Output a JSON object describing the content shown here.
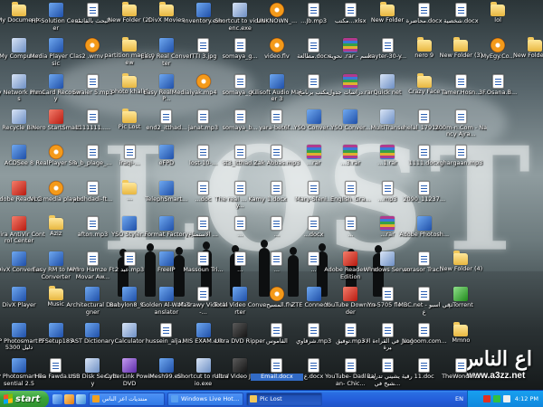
{
  "desktop": {
    "icons": [
      {
        "label": "My Documents",
        "type": "folder",
        "col": 0,
        "row": 0
      },
      {
        "label": "HP Solution Center",
        "type": "app",
        "col": 1,
        "row": 0
      },
      {
        "label": "البحث بالقائمة",
        "type": "doc",
        "col": 2,
        "row": 0
      },
      {
        "label": "New Folder (2)",
        "type": "folder",
        "col": 3,
        "row": 0
      },
      {
        "label": "DivX Movies",
        "type": "folder",
        "col": 4,
        "row": 0
      },
      {
        "label": "Inventory.exe",
        "type": "app",
        "col": 5,
        "row": 0
      },
      {
        "label": "Shortcut to videoenc.exe",
        "type": "sys",
        "col": 6,
        "row": 0
      },
      {
        "label": "UNKNOWN_...",
        "type": "media",
        "col": 7,
        "row": 0
      },
      {
        "label": "...Jb.mp3",
        "type": "doc",
        "col": 8,
        "row": 0
      },
      {
        "label": "مکتب...xlsx",
        "type": "doc",
        "col": 9,
        "row": 0
      },
      {
        "label": "New Folder",
        "type": "folder",
        "col": 10,
        "row": 0
      },
      {
        "label": "محاضرة.docx",
        "type": "doc",
        "col": 11,
        "row": 0
      },
      {
        "label": "شخصية.docx",
        "type": "doc",
        "col": 12,
        "row": 0
      },
      {
        "label": "lol",
        "type": "folder",
        "col": 13,
        "row": 0
      },
      {
        "label": "My Computer",
        "type": "sys",
        "col": 0,
        "row": 1
      },
      {
        "label": "Media Player Classic",
        "type": "app",
        "col": 1,
        "row": 1
      },
      {
        "label": "2 .wmv",
        "type": "media",
        "col": 2,
        "row": 1
      },
      {
        "label": "partition magic new",
        "type": "folder",
        "col": 3,
        "row": 1
      },
      {
        "label": "Easy Real Converter",
        "type": "app",
        "col": 4,
        "row": 1
      },
      {
        "label": "ITTI 3.jpg",
        "type": "doc",
        "col": 5,
        "row": 1
      },
      {
        "label": "somaya_g...",
        "type": "doc",
        "col": 6,
        "row": 1
      },
      {
        "label": "video.flv",
        "type": "media",
        "col": 7,
        "row": 1
      },
      {
        "label": "مطالعة.docx",
        "type": "doc",
        "col": 8,
        "row": 1
      },
      {
        "label": "نحوية .rar - قسم",
        "type": "archive",
        "col": 9,
        "row": 1
      },
      {
        "label": "kayter-30-y...",
        "type": "doc",
        "col": 10,
        "row": 1
      },
      {
        "label": "nero 9",
        "type": "folder",
        "col": 11,
        "row": 1
      },
      {
        "label": "New Folder (3)",
        "type": "folder",
        "col": 12,
        "row": 1
      },
      {
        "label": "MyEgy.Co...",
        "type": "media",
        "col": 13,
        "row": 1
      },
      {
        "label": "New Folder (5)",
        "type": "folder",
        "col": 14,
        "row": 1
      },
      {
        "label": "My Network Places",
        "type": "sys",
        "col": 0,
        "row": 2
      },
      {
        "label": "mmCard Recovery",
        "type": "app",
        "col": 1,
        "row": 2
      },
      {
        "label": "Swaier 5.mp3",
        "type": "doc",
        "col": 2,
        "row": 2
      },
      {
        "label": "photo khalid",
        "type": "folder",
        "col": 3,
        "row": 2
      },
      {
        "label": "Easy RealMedia P...",
        "type": "app",
        "col": 4,
        "row": 2
      },
      {
        "label": "iyak.mp4",
        "type": "media",
        "col": 5,
        "row": 2
      },
      {
        "label": "somaya_g...",
        "type": "doc",
        "col": 6,
        "row": 2
      },
      {
        "label": "Xilisoft Audio Maker 3",
        "type": "app",
        "col": 7,
        "row": 2
      },
      {
        "label": "مكتب برنامج",
        "type": "doc",
        "col": 8,
        "row": 2
      },
      {
        "label": "دراسات جدول.rar",
        "type": "archive",
        "col": 9,
        "row": 2
      },
      {
        "label": "Quick net",
        "type": "sys",
        "col": 10,
        "row": 2
      },
      {
        "label": "Crazy Face",
        "type": "folder",
        "col": 11,
        "row": 2
      },
      {
        "label": "Tamer.Hosn...",
        "type": "doc",
        "col": 12,
        "row": 2
      },
      {
        "label": "3F.Osana.B...",
        "type": "doc",
        "col": 13,
        "row": 2
      },
      {
        "label": "Recycle Bin",
        "type": "sys",
        "col": 0,
        "row": 3
      },
      {
        "label": "Nero StartSmart",
        "type": "red",
        "col": 1,
        "row": 3
      },
      {
        "label": "1111111.....",
        "type": "doc",
        "col": 2,
        "row": 3
      },
      {
        "label": "Pic Lost",
        "type": "folder",
        "col": 3,
        "row": 3
      },
      {
        "label": "end2_itthad...",
        "type": "doc",
        "col": 4,
        "row": 3
      },
      {
        "label": "janat.mp3",
        "type": "doc",
        "col": 5,
        "row": 3
      },
      {
        "label": "somaya_b...",
        "type": "doc",
        "col": 6,
        "row": 3
      },
      {
        "label": "yara-bet6f...",
        "type": "doc",
        "col": 7,
        "row": 3
      },
      {
        "label": "YSO Conver...",
        "type": "app",
        "col": 8,
        "row": 3
      },
      {
        "label": "YSO Conver...",
        "type": "app",
        "col": 9,
        "row": 3
      },
      {
        "label": "MultiTranse",
        "type": "sys",
        "col": 10,
        "row": 3
      },
      {
        "label": "helal_1791S...",
        "type": "doc",
        "col": 11,
        "row": 3
      },
      {
        "label": "200m-n.Com - Nancy Ajra...",
        "type": "doc",
        "col": 12,
        "row": 3
      },
      {
        "label": "ACDSee 8",
        "type": "app",
        "col": 0,
        "row": 4
      },
      {
        "label": "RealPlayer SP",
        "type": "media",
        "col": 1,
        "row": 4
      },
      {
        "label": "a_b_plage_...",
        "type": "doc",
        "col": 2,
        "row": 4
      },
      {
        "label": "iraqi-...",
        "type": "doc",
        "col": 3,
        "row": 4
      },
      {
        "label": "eFPD",
        "type": "app",
        "col": 4,
        "row": 4
      },
      {
        "label": "lost-10-...",
        "type": "doc",
        "col": 5,
        "row": 4
      },
      {
        "label": "st3_itthad...",
        "type": "doc",
        "col": 6,
        "row": 4
      },
      {
        "label": "Zak Abbas.mp3",
        "type": "doc",
        "col": 7,
        "row": 4
      },
      {
        "label": "...rar",
        "type": "archive",
        "col": 8,
        "row": 4
      },
      {
        "label": "...3.rar",
        "type": "archive",
        "col": 9,
        "row": 4
      },
      {
        "label": "...1.rar",
        "type": "archive",
        "col": 10,
        "row": 4
      },
      {
        "label": "1111.docx",
        "type": "doc",
        "col": 11,
        "row": 4
      },
      {
        "label": "ghargaan.mp3",
        "type": "doc",
        "col": 12,
        "row": 4
      },
      {
        "label": "Adobe Reader 8",
        "type": "red",
        "col": 0,
        "row": 5
      },
      {
        "label": "VLC media player",
        "type": "media",
        "col": 1,
        "row": 5
      },
      {
        "label": "abdhdadi-ft...",
        "type": "doc",
        "col": 2,
        "row": 5
      },
      {
        "label": "...",
        "type": "folder",
        "col": 3,
        "row": 5
      },
      {
        "label": "TelephSmart...",
        "type": "app",
        "col": 4,
        "row": 5
      },
      {
        "label": "...doc",
        "type": "doc",
        "col": 5,
        "row": 5
      },
      {
        "label": "The real ... Kamyy...",
        "type": "doc",
        "col": 6,
        "row": 5
      },
      {
        "label": "1.docx",
        "type": "doc",
        "col": 7,
        "row": 5
      },
      {
        "label": "Mary-Sfeni...",
        "type": "doc",
        "col": 8,
        "row": 5
      },
      {
        "label": "English_Gra...",
        "type": "doc",
        "col": 9,
        "row": 5
      },
      {
        "label": "...mp3",
        "type": "doc",
        "col": 10,
        "row": 5
      },
      {
        "label": "2090_11237...",
        "type": "doc",
        "col": 11,
        "row": 5
      },
      {
        "label": "Avira AntiVir Control Center",
        "type": "red",
        "col": 0,
        "row": 6
      },
      {
        "label": "Aziz",
        "type": "folder",
        "col": 1,
        "row": 6
      },
      {
        "label": "afton.mp3",
        "type": "doc",
        "col": 2,
        "row": 6
      },
      {
        "label": "YSO Styler...",
        "type": "app",
        "col": 3,
        "row": 6
      },
      {
        "label": "Format Factory",
        "type": "app",
        "col": 4,
        "row": 6
      },
      {
        "label": "الاستمتاع ...",
        "type": "doc",
        "col": 5,
        "row": 6
      },
      {
        "label": "...",
        "type": "doc",
        "col": 6,
        "row": 6
      },
      {
        "label": "...",
        "type": "doc",
        "col": 7,
        "row": 6
      },
      {
        "label": "...docx",
        "type": "doc",
        "col": 8,
        "row": 6
      },
      {
        "label": "...",
        "type": "doc",
        "col": 9,
        "row": 6
      },
      {
        "label": "...rar",
        "type": "archive",
        "col": 10,
        "row": 6
      },
      {
        "label": "Adobe Photosh...",
        "type": "app",
        "col": 11,
        "row": 6
      },
      {
        "label": "DivX Converter",
        "type": "app",
        "col": 0,
        "row": 7
      },
      {
        "label": "Easy RM to MP3 Converter",
        "type": "app",
        "col": 1,
        "row": 7
      },
      {
        "label": "Amro Hamze Ft. Movar Aw...",
        "type": "doc",
        "col": 2,
        "row": 7
      },
      {
        "label": "عبد 2.mp3",
        "type": "doc",
        "col": 3,
        "row": 7
      },
      {
        "label": "FreeIP",
        "type": "app",
        "col": 4,
        "row": 7
      },
      {
        "label": "Massoun Tri...",
        "type": "doc",
        "col": 5,
        "row": 7
      },
      {
        "label": "...",
        "type": "doc",
        "col": 6,
        "row": 7
      },
      {
        "label": "...",
        "type": "doc",
        "col": 7,
        "row": 7
      },
      {
        "label": "...",
        "type": "doc",
        "col": 8,
        "row": 7
      },
      {
        "label": "Adobe Reader Pro Edition",
        "type": "red",
        "col": 9,
        "row": 7
      },
      {
        "label": "Windows Server",
        "type": "sys",
        "col": 10,
        "row": 7
      },
      {
        "label": "sorasor Trac...",
        "type": "doc",
        "col": 11,
        "row": 7
      },
      {
        "label": "New Folder (4)",
        "type": "folder",
        "col": 12,
        "row": 7
      },
      {
        "label": "DivX Player",
        "type": "app",
        "col": 0,
        "row": 8
      },
      {
        "label": "Music",
        "type": "folder",
        "col": 1,
        "row": 8
      },
      {
        "label": "Architectural Designer",
        "type": "app",
        "col": 2,
        "row": 8
      },
      {
        "label": "Babylon8_9...",
        "type": "app",
        "col": 3,
        "row": 8
      },
      {
        "label": "Golden Al-Wafi Translator",
        "type": "app",
        "col": 4,
        "row": 8
      },
      {
        "label": "Masrawy Videola-...",
        "type": "doc",
        "col": 5,
        "row": 8
      },
      {
        "label": "Total Video Converter",
        "type": "app",
        "col": 6,
        "row": 8
      },
      {
        "label": "...المسيح.flv",
        "type": "media",
        "col": 7,
        "row": 8
      },
      {
        "label": "ZTE Connecti...",
        "type": "app",
        "col": 8,
        "row": 8
      },
      {
        "label": "YouTube Downloader",
        "type": "red",
        "col": 9,
        "row": 8
      },
      {
        "label": "Yn-5705 fle...",
        "type": "doc",
        "col": 10,
        "row": 8
      },
      {
        "label": "MBC.net - في اسبوع",
        "type": "doc",
        "col": 11,
        "row": 8
      },
      {
        "label": "μTorrent",
        "type": "green",
        "col": 12,
        "row": 8
      },
      {
        "label": "HP Photosmart D5300 دليل",
        "type": "app",
        "col": 0,
        "row": 9
      },
      {
        "label": "PFSetup185",
        "type": "app",
        "col": 1,
        "row": 9
      },
      {
        "label": "AST Dictionary",
        "type": "app",
        "col": 2,
        "row": 9
      },
      {
        "label": "Calculator",
        "type": "sys",
        "col": 3,
        "row": 9
      },
      {
        "label": "hussein_alja...",
        "type": "doc",
        "col": 4,
        "row": 9
      },
      {
        "label": "MIS EXAM.exe",
        "type": "app",
        "col": 5,
        "row": 9
      },
      {
        "label": "Ultra DVD Ripper",
        "type": "dark",
        "col": 6,
        "row": 9
      },
      {
        "label": "القاموس",
        "type": "doc",
        "col": 7,
        "row": 9
      },
      {
        "label": "شرقاوي.mp3",
        "type": "doc",
        "col": 8,
        "row": 9
      },
      {
        "label": "توفيق.mp3",
        "type": "doc",
        "col": 9,
        "row": 9
      },
      {
        "label": "انشر في القراءة الأخيرة",
        "type": "doc",
        "col": 10,
        "row": 9
      },
      {
        "label": "Nogoom.com...",
        "type": "doc",
        "col": 11,
        "row": 9
      },
      {
        "label": "Mmno",
        "type": "folder",
        "col": 12,
        "row": 9
      },
      {
        "label": "HP Photosmart Essential 2.5",
        "type": "app",
        "col": 0,
        "row": 10
      },
      {
        "label": "Hea Fawda.mr",
        "type": "doc",
        "col": 1,
        "row": 10
      },
      {
        "label": "USB Disk Security",
        "type": "sys",
        "col": 2,
        "row": 10
      },
      {
        "label": "CyberLink PowerDVD",
        "type": "purple",
        "col": 3,
        "row": 10
      },
      {
        "label": "iMesh99.exe",
        "type": "app",
        "col": 4,
        "row": 10
      },
      {
        "label": "Shortcut to r-studio.exe",
        "type": "sys",
        "col": 5,
        "row": 10
      },
      {
        "label": "Ultra Video Joiner",
        "type": "dark",
        "col": 6,
        "row": 10
      },
      {
        "label": "Email.docx",
        "type": "doc",
        "col": 7,
        "row": 10,
        "selected": true
      },
      {
        "label": "ع.docx",
        "type": "doc",
        "col": 8,
        "row": 10
      },
      {
        "label": "YouTube- Dan Balan- Chic...",
        "type": "doc",
        "col": 9,
        "row": 10
      },
      {
        "label": "رقية يشيني تدريب الشيخ في...",
        "type": "doc",
        "col": 10,
        "row": 10
      },
      {
        "label": "11.doc",
        "type": "doc",
        "col": 11,
        "row": 10
      },
      {
        "label": "TheWonder...",
        "type": "doc",
        "col": 12,
        "row": 10
      }
    ],
    "watermark": {
      "arabic": "اع الناس",
      "url": "www.a3zz.net"
    }
  },
  "taskbar": {
    "start_label": "start",
    "tasks": [
      {
        "label": "منتديات اعز الناس",
        "active": false
      },
      {
        "label": "Windows Live Hotmail...",
        "active": false
      },
      {
        "label": "Pic Lost",
        "active": true
      }
    ],
    "language": "EN",
    "clock": "4:12 PM"
  },
  "colors": {
    "taskbar_blue": "#245edb",
    "start_green": "#3aa53a",
    "tray_blue": "#0f86dd",
    "selection": "#316ac5"
  }
}
